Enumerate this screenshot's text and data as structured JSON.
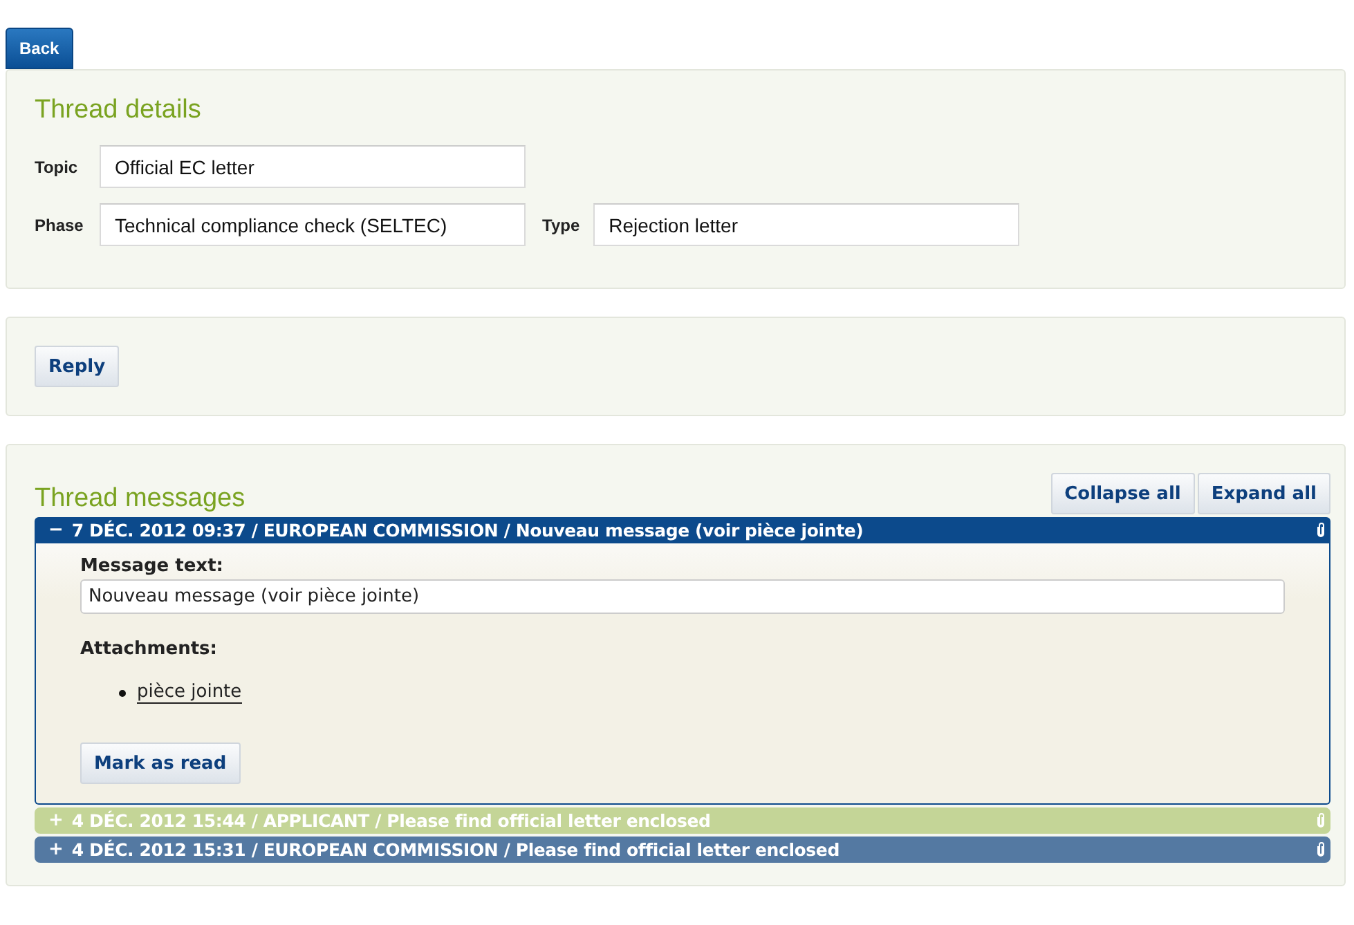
{
  "back_button": "Back",
  "thread_details": {
    "title": "Thread details",
    "fields": [
      {
        "label": "Topic",
        "value": "Official EC letter"
      },
      {
        "label": "Phase",
        "value": "Technical compliance check (SELTEC)"
      },
      {
        "label": "Type",
        "value": "Rejection letter"
      }
    ]
  },
  "reply_button": "Reply",
  "thread_messages": {
    "title": "Thread messages",
    "buttons": [
      "Collapse all",
      "Expand all"
    ],
    "messages": [
      {
        "toggle": "−",
        "header": "7 DÉC. 2012 09:37 / EUROPEAN COMMISSION / Nouveau message (voir pièce jointe)",
        "color": "#0c4a8c",
        "expanded": true,
        "message_label": "Message text:",
        "message_text": "Nouveau message (voir pièce jointe)",
        "attachments_label": "Attachments:",
        "attachments": [
          "pièce jointe"
        ],
        "action_button": "Mark as read"
      },
      {
        "toggle": "+",
        "header": "4 DÉC. 2012 15:44 / APPLICANT / Please find official letter enclosed",
        "color": "#c4d597",
        "expanded": false
      },
      {
        "toggle": "+",
        "header": "4 DÉC. 2012 15:31 / EUROPEAN COMMISSION / Please find official letter enclosed",
        "color": "#5479a2",
        "expanded": false
      }
    ]
  }
}
